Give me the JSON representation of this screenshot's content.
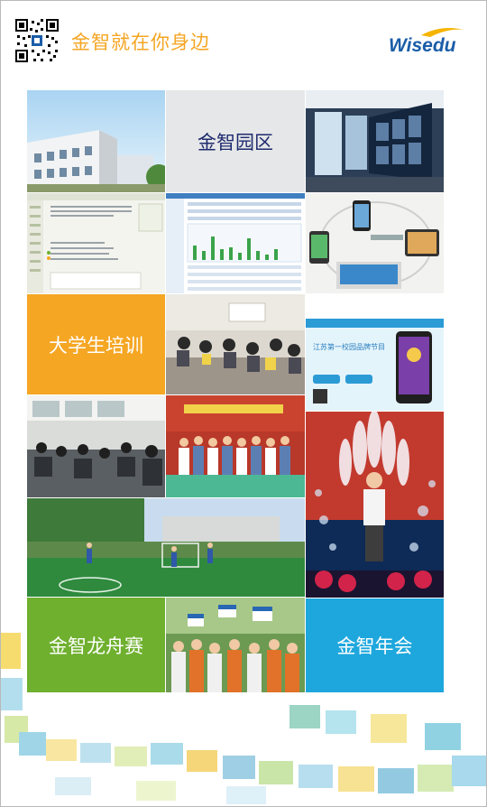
{
  "header": {
    "slogan": "金智就在你身边",
    "logo_text": "Wisedu",
    "qr_icon": "qr-code-icon"
  },
  "tiles": {
    "campus_label": "金智园区",
    "training_label": "大学生培训",
    "dragon_boat_label": "金智龙舟赛",
    "annual_party_label": "金智年会",
    "app_banner_text": "江苏第一校园品牌节目"
  },
  "colors": {
    "accent_orange": "#f5a623",
    "brand_blue": "#1a5da8",
    "green_tile": "#6fb02f",
    "cyan_tile": "#1ea7dd",
    "gray_tile": "#e6e7e8"
  }
}
